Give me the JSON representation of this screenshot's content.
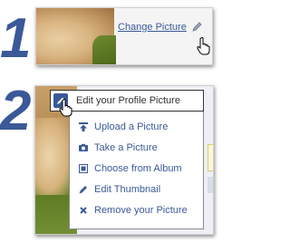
{
  "step_numbers": [
    "1",
    "2"
  ],
  "panel1": {
    "link_label": "Change Picture",
    "pencil_icon": "pencil-icon",
    "cursor_icon": "hand-pointer-icon"
  },
  "panel2": {
    "header_label": "Edit your Profile Picture",
    "header_icon": "pencil-icon",
    "menu_items": [
      {
        "label": "Upload a Picture",
        "icon": "upload-icon"
      },
      {
        "label": "Take a Picture",
        "icon": "camera-icon"
      },
      {
        "label": "Choose from Album",
        "icon": "album-icon"
      },
      {
        "label": "Edit Thumbnail",
        "icon": "pencil-icon"
      },
      {
        "label": "Remove your Picture",
        "icon": "close-icon"
      }
    ]
  },
  "colors": {
    "accent": "#3b5998",
    "text": "#333333",
    "highlight": "#fff8d8"
  }
}
